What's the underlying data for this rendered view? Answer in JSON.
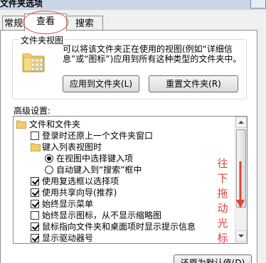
{
  "window": {
    "title": "文件夹选项"
  },
  "tabs": [
    {
      "label": "常规",
      "active": false
    },
    {
      "label": "查看",
      "active": true
    },
    {
      "label": "搜索",
      "active": false
    }
  ],
  "folder_views": {
    "group_title": "文件夹视图",
    "description": "可以将该文件夹正在使用的视图(例如“详细信息”或“图标”)应用到所有这种类型的文件夹中。",
    "apply_button": "应用到文件夹(L)",
    "reset_button": "重置文件夹(R)"
  },
  "advanced": {
    "label": "高级设置:",
    "items": [
      {
        "type": "folder",
        "label": "文件和文件夹",
        "indent": 0
      },
      {
        "type": "checkbox",
        "checked": false,
        "label": "登录时还原上一个文件夹窗口",
        "indent": 1
      },
      {
        "type": "folder",
        "label": "键入列表视图时",
        "indent": 1
      },
      {
        "type": "radio",
        "checked": true,
        "label": "在视图中选择键入项",
        "indent": 2
      },
      {
        "type": "radio",
        "checked": false,
        "label": "自动键入到“搜索”框中",
        "indent": 2
      },
      {
        "type": "checkbox",
        "checked": true,
        "label": "使用复选框以选择项",
        "indent": 1
      },
      {
        "type": "checkbox",
        "checked": true,
        "label": "使用共享向导(推荐)",
        "indent": 1
      },
      {
        "type": "checkbox",
        "checked": true,
        "label": "始终显示菜单",
        "indent": 1
      },
      {
        "type": "checkbox",
        "checked": false,
        "label": "始终显示图标，从不显示缩略图",
        "indent": 1
      },
      {
        "type": "checkbox",
        "checked": true,
        "label": "鼠标指向文件夹和桌面项时显示提示信息",
        "indent": 1
      },
      {
        "type": "checkbox",
        "checked": true,
        "label": "显示驱动器号",
        "indent": 1
      }
    ],
    "restore_defaults_button": "还原为默认值(D)"
  },
  "annotation": {
    "text": [
      "往",
      "下",
      "拖",
      "动",
      "光",
      "标"
    ],
    "color": "#e0423a"
  },
  "colors": {
    "annotation_red": "#e0423a",
    "border": "#8d8d8d"
  }
}
